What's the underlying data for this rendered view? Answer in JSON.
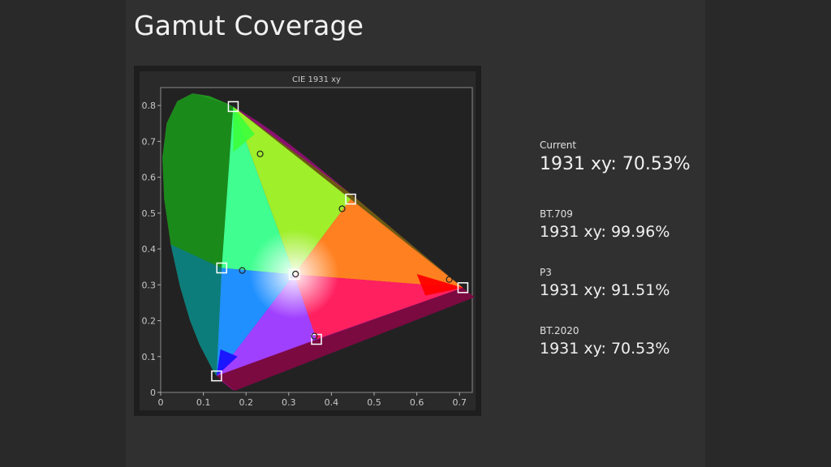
{
  "page": {
    "title": "Gamut Coverage"
  },
  "stats": [
    {
      "label": "Current",
      "value": "1931 xy: 70.53%"
    },
    {
      "label": "BT.709",
      "value": "1931 xy: 99.96%"
    },
    {
      "label": "P3",
      "value": "1931 xy: 91.51%"
    },
    {
      "label": "BT.2020",
      "value": "1931 xy: 70.53%"
    }
  ],
  "chart_data": {
    "type": "scatter",
    "title": "CIE 1931 xy",
    "xlabel": "",
    "ylabel": "",
    "xlim": [
      0,
      0.73
    ],
    "ylim": [
      0,
      0.85
    ],
    "x_ticks": [
      "0",
      "0.1",
      "0.2",
      "0.3",
      "0.4",
      "0.5",
      "0.6",
      "0.7"
    ],
    "y_ticks": [
      "0",
      "0.1",
      "0.2",
      "0.3",
      "0.4",
      "0.5",
      "0.6",
      "0.7",
      "0.8"
    ],
    "grid": false,
    "series": [
      {
        "marker": "square",
        "points": [
          {
            "x": 0.17,
            "y": 0.797
          },
          {
            "x": 0.708,
            "y": 0.292
          },
          {
            "x": 0.131,
            "y": 0.046
          },
          {
            "x": 0.445,
            "y": 0.539
          },
          {
            "x": 0.143,
            "y": 0.347
          },
          {
            "x": 0.365,
            "y": 0.148
          },
          {
            "x": 0.313,
            "y": 0.329
          }
        ]
      },
      {
        "marker": "circle",
        "points": [
          {
            "x": 0.233,
            "y": 0.665
          },
          {
            "x": 0.676,
            "y": 0.315
          },
          {
            "x": 0.425,
            "y": 0.512
          },
          {
            "x": 0.191,
            "y": 0.34
          },
          {
            "x": 0.36,
            "y": 0.157
          },
          {
            "x": 0.316,
            "y": 0.33
          }
        ]
      }
    ]
  }
}
